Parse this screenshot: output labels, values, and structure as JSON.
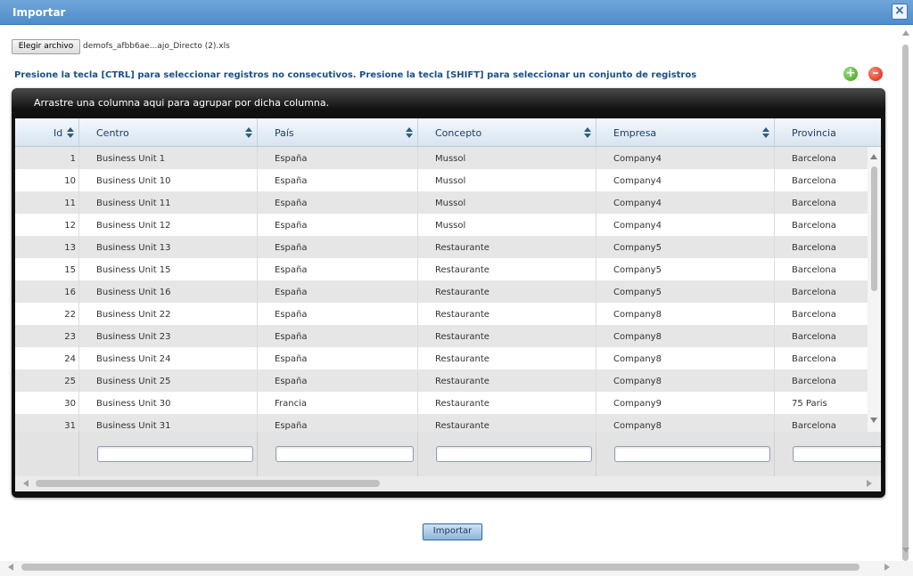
{
  "dialog": {
    "title": "Importar",
    "close_icon": "close-icon"
  },
  "file": {
    "button_label": "Elegir archivo",
    "file_name": "demofs_afbb6ae...ajo_Directo (2).xls"
  },
  "hint_text": "Presione la tecla [CTRL] para seleccionar registros no consecutivos. Presione la tecla [SHIFT] para seleccionar un conjunto de registros",
  "actions": {
    "add_icon": "plus-circle-icon",
    "add_glyph": "+",
    "remove_icon": "minus-circle-icon",
    "remove_glyph": "–"
  },
  "grid": {
    "group_panel_text": "Arrastre una columna aqui para agrupar por dicha columna.",
    "columns": [
      {
        "label": "Id"
      },
      {
        "label": "Centro"
      },
      {
        "label": "País"
      },
      {
        "label": "Concepto"
      },
      {
        "label": "Empresa"
      },
      {
        "label": "Provincia"
      }
    ],
    "rows": [
      [
        "1",
        "Business Unit 1",
        "España",
        "Mussol",
        "Company4",
        "Barcelona"
      ],
      [
        "10",
        "Business Unit 10",
        "España",
        "Mussol",
        "Company4",
        "Barcelona"
      ],
      [
        "11",
        "Business Unit 11",
        "España",
        "Mussol",
        "Company4",
        "Barcelona"
      ],
      [
        "12",
        "Business Unit 12",
        "España",
        "Mussol",
        "Company4",
        "Barcelona"
      ],
      [
        "13",
        "Business Unit 13",
        "España",
        "Restaurante",
        "Company5",
        "Barcelona"
      ],
      [
        "15",
        "Business Unit 15",
        "España",
        "Restaurante",
        "Company5",
        "Barcelona"
      ],
      [
        "16",
        "Business Unit 16",
        "España",
        "Restaurante",
        "Company5",
        "Barcelona"
      ],
      [
        "22",
        "Business Unit 22",
        "España",
        "Restaurante",
        "Company8",
        "Barcelona"
      ],
      [
        "23",
        "Business Unit 23",
        "España",
        "Restaurante",
        "Company8",
        "Barcelona"
      ],
      [
        "24",
        "Business Unit 24",
        "España",
        "Restaurante",
        "Company8",
        "Barcelona"
      ],
      [
        "25",
        "Business Unit 25",
        "España",
        "Restaurante",
        "Company8",
        "Barcelona"
      ],
      [
        "30",
        "Business Unit 30",
        "Francia",
        "Restaurante",
        "Company9",
        "75 Paris"
      ],
      [
        "31",
        "Business Unit 31",
        "España",
        "Restaurante",
        "Company8",
        "Barcelona"
      ]
    ]
  },
  "import_button_label": "Importar"
}
